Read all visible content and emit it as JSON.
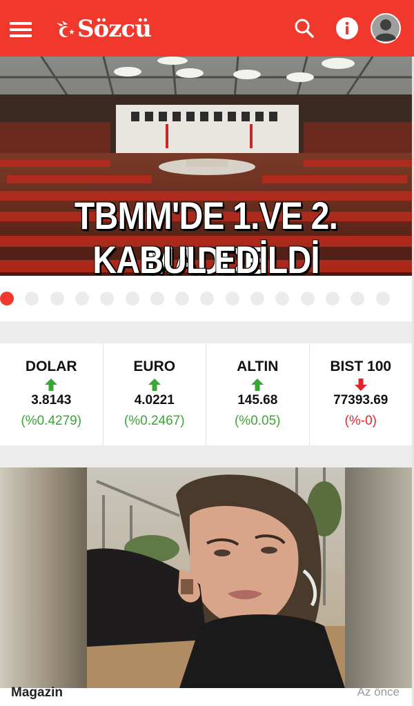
{
  "app": {
    "brand": "Sözcü"
  },
  "hero": {
    "headline_line1": "TBMM'DE 1.VE 2. MADDE",
    "headline_line2": "KABUL EDİLDİ",
    "slide_count": 16,
    "active_slide": 1
  },
  "markets": [
    {
      "name": "DOLAR",
      "value": "3.8143",
      "change": "(%0.4279)",
      "trend": "up"
    },
    {
      "name": "EURO",
      "value": "4.0221",
      "change": "(%0.2467)",
      "trend": "up"
    },
    {
      "name": "ALTIN",
      "value": "145.68",
      "change": "(%0.05)",
      "trend": "up"
    },
    {
      "name": "BIST 100",
      "value": "77393.69",
      "change": "(%-0)",
      "trend": "down"
    }
  ],
  "card": {
    "category": "Magazin",
    "time": "Az önce"
  },
  "colors": {
    "brand": "#f0392c",
    "up": "#3aa635",
    "down": "#e0262a"
  },
  "icons": {
    "menu": "menu-icon",
    "search": "search-icon",
    "info": "info-icon",
    "avatar": "user-avatar-icon",
    "up": "arrow-up-icon",
    "down": "arrow-down-icon"
  }
}
